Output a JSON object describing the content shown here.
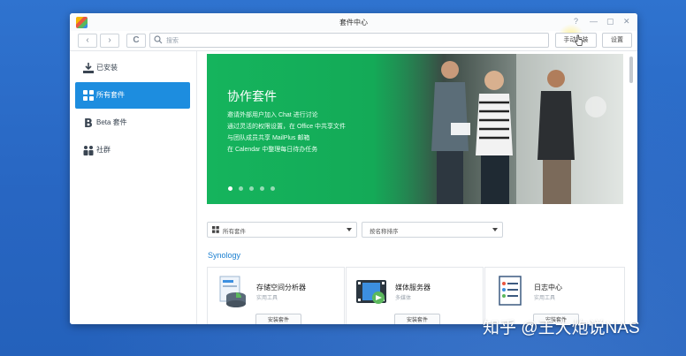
{
  "window": {
    "title": "套件中心",
    "controls": {
      "help": "?",
      "minimize": "—",
      "maximize": "▢",
      "close": "✕"
    }
  },
  "toolbar": {
    "back": "‹",
    "forward": "›",
    "refresh": "C",
    "search_placeholder": "搜索",
    "manual_install": "手动安装",
    "settings": "设置"
  },
  "sidebar": {
    "items": [
      {
        "label": "已安装",
        "icon": "download-icon",
        "active": false
      },
      {
        "label": "所有套件",
        "icon": "grid-icon",
        "active": true
      },
      {
        "label": "Beta 套件",
        "icon": "beta-icon",
        "active": false
      },
      {
        "label": "社群",
        "icon": "community-icon",
        "active": false
      }
    ]
  },
  "banner": {
    "title": "协作套件",
    "lines": [
      "邀请外部用户加入 Chat 进行讨论",
      "通过灵活的权限设置，在 Office 中共享文件",
      "与团队成员共享 MailPlus 邮箱",
      "在 Calendar 中整理每日待办任务"
    ],
    "dots": 5,
    "active_dot": 0
  },
  "filters": {
    "type": "所有套件",
    "sort": "按名称排序"
  },
  "section_title": "Synology",
  "packages": [
    {
      "name": "存储空间分析器",
      "category": "实用工具",
      "button": "安装套件",
      "icon": "storage-analyzer-icon"
    },
    {
      "name": "媒体服务器",
      "category": "多媒体",
      "button": "安装套件",
      "icon": "media-server-icon"
    },
    {
      "name": "日志中心",
      "category": "实用工具",
      "button": "安装套件",
      "icon": "log-center-icon"
    }
  ],
  "watermark": "知乎 @王大炮说NAS",
  "colors": {
    "accent": "#1d8ddf",
    "banner_green": "#15b45d",
    "desktop": "#2c6cc8"
  }
}
